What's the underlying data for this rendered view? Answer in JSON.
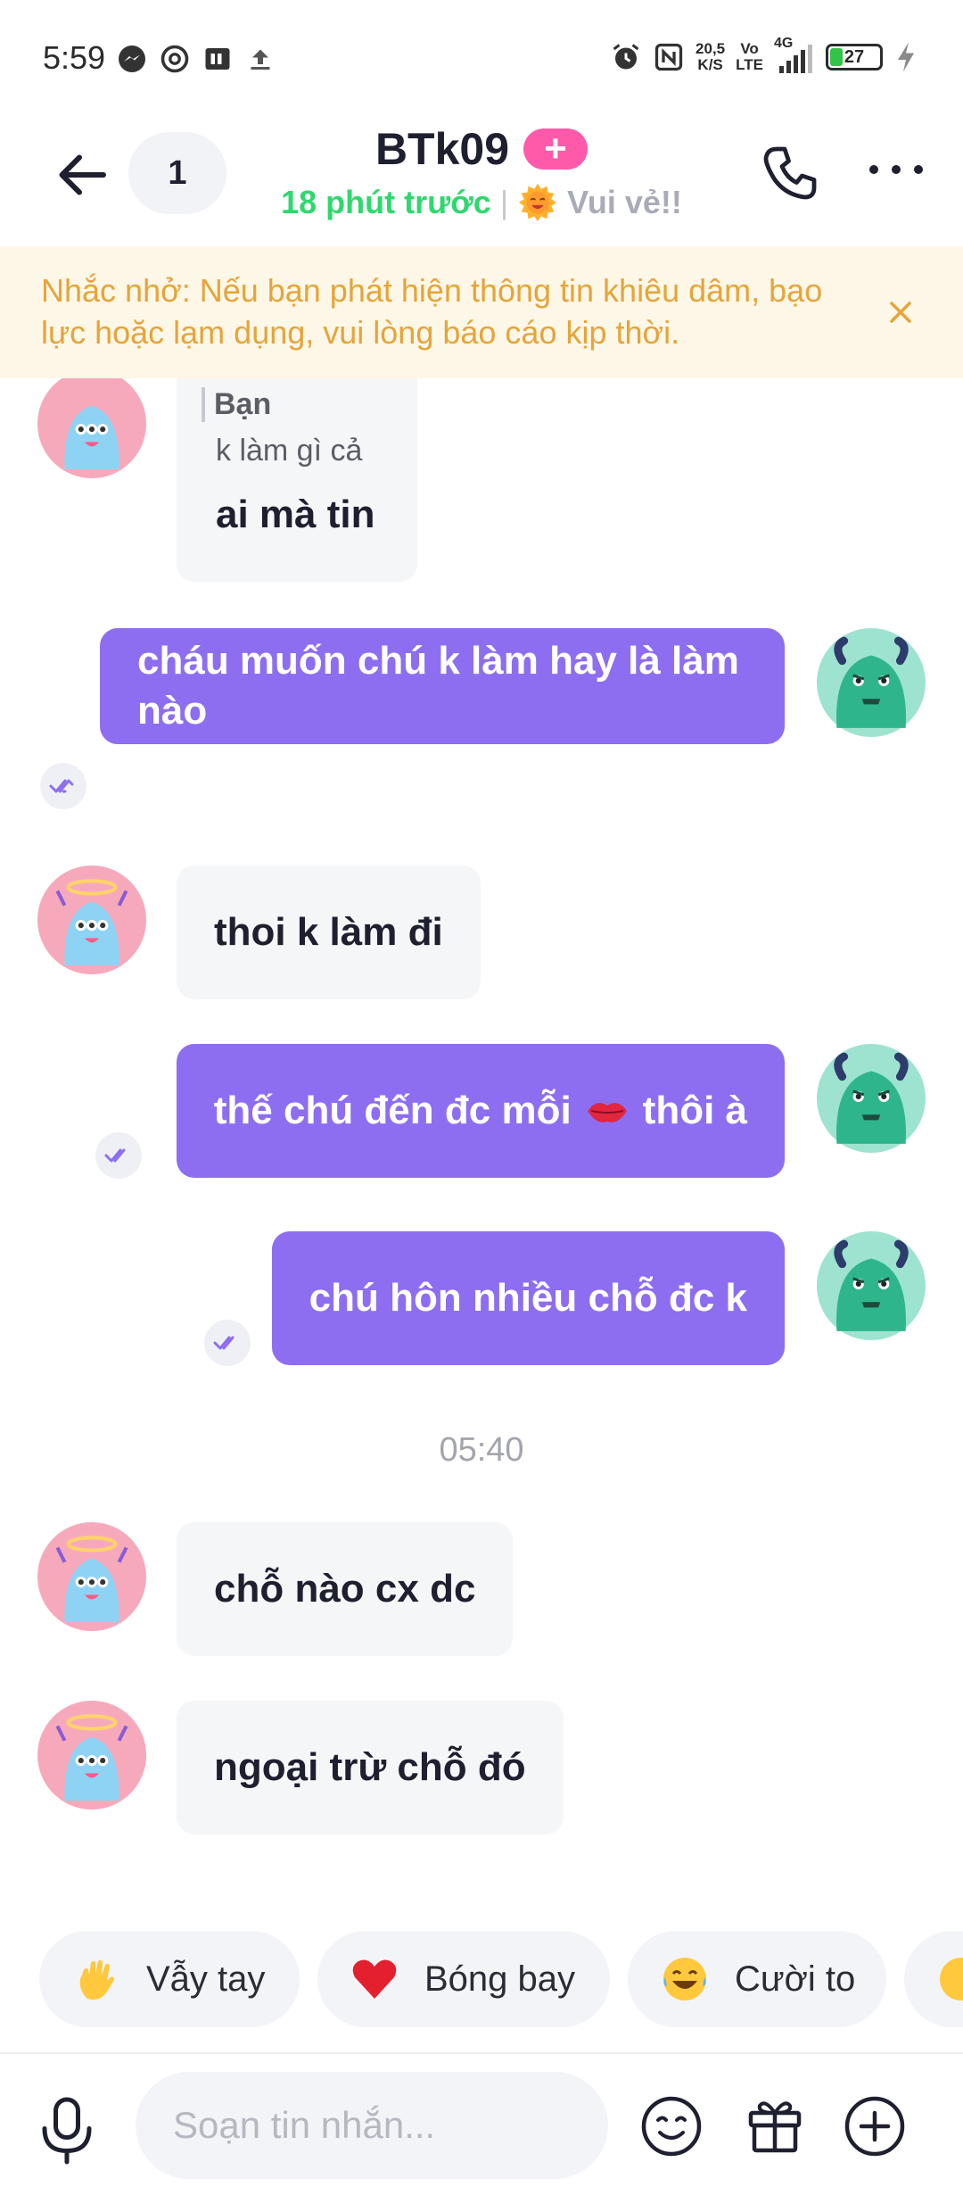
{
  "status_bar": {
    "time": "5:59",
    "net_speed_value": "20,5",
    "net_speed_unit": "K/S",
    "volte_top": "Vo",
    "volte_bottom": "LTE",
    "network": "4G",
    "battery": "27",
    "left_icons": [
      "messenger-icon",
      "threads-icon",
      "app-icon",
      "upload-icon"
    ],
    "right_icons": [
      "alarm-icon",
      "nfc-icon",
      "signal-icon",
      "battery-icon",
      "charging-icon"
    ]
  },
  "header": {
    "unread_count": "1",
    "title": "BTk09",
    "plus_label": "+",
    "last_seen": "18 phút trước",
    "separator": "|",
    "mood": "Vui vẻ!!"
  },
  "banner": {
    "text": "Nhắc nhở: Nếu bạn phát hiện thông tin khiêu dâm, bạo lực hoặc lạm dụng, vui lòng báo cáo kịp thời."
  },
  "messages": {
    "quoted": {
      "name": "Bạn",
      "text": "k làm gì cả",
      "reply": "ai mà tin"
    },
    "m1": "cháu muốn chú k làm hay là làm nào",
    "m2": "thoi k làm đi",
    "m3_before": "thế chú đến đc mỗi",
    "m3_after": "thôi à",
    "m4": "chú hôn nhiều chỗ đc k",
    "time_separator": "05:40",
    "m5": "chỗ nào cx dc",
    "m6": "ngoại trừ chỗ đó"
  },
  "quick_reactions": [
    {
      "label": "Vẫy tay",
      "icon": "waving-hand-icon"
    },
    {
      "label": "Bóng bay",
      "icon": "heart-balloon-icon"
    },
    {
      "label": "Cười to",
      "icon": "laughing-face-icon"
    }
  ],
  "composer": {
    "placeholder": "Soạn tin nhắn..."
  },
  "colors": {
    "outgoing_bubble": "#8d6ef0",
    "incoming_bubble": "#f5f6f8",
    "online_green": "#2fd86e",
    "banner_bg": "#fdf7e7",
    "banner_text": "#e6a43a",
    "plus_badge": "#ff5aa9"
  }
}
